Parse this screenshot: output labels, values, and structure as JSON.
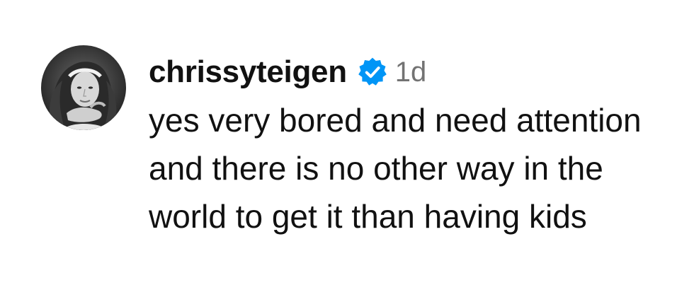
{
  "comment": {
    "username": "chrissyteigen",
    "verified": true,
    "verified_icon": "verified-badge-icon",
    "timestamp": "1d",
    "text": "yes very bored and need attention and there is no other way in the world to get it than having kids"
  },
  "colors": {
    "verified_badge": "#0095f6",
    "timestamp": "#737373",
    "text": "#111111",
    "background": "#ffffff"
  }
}
